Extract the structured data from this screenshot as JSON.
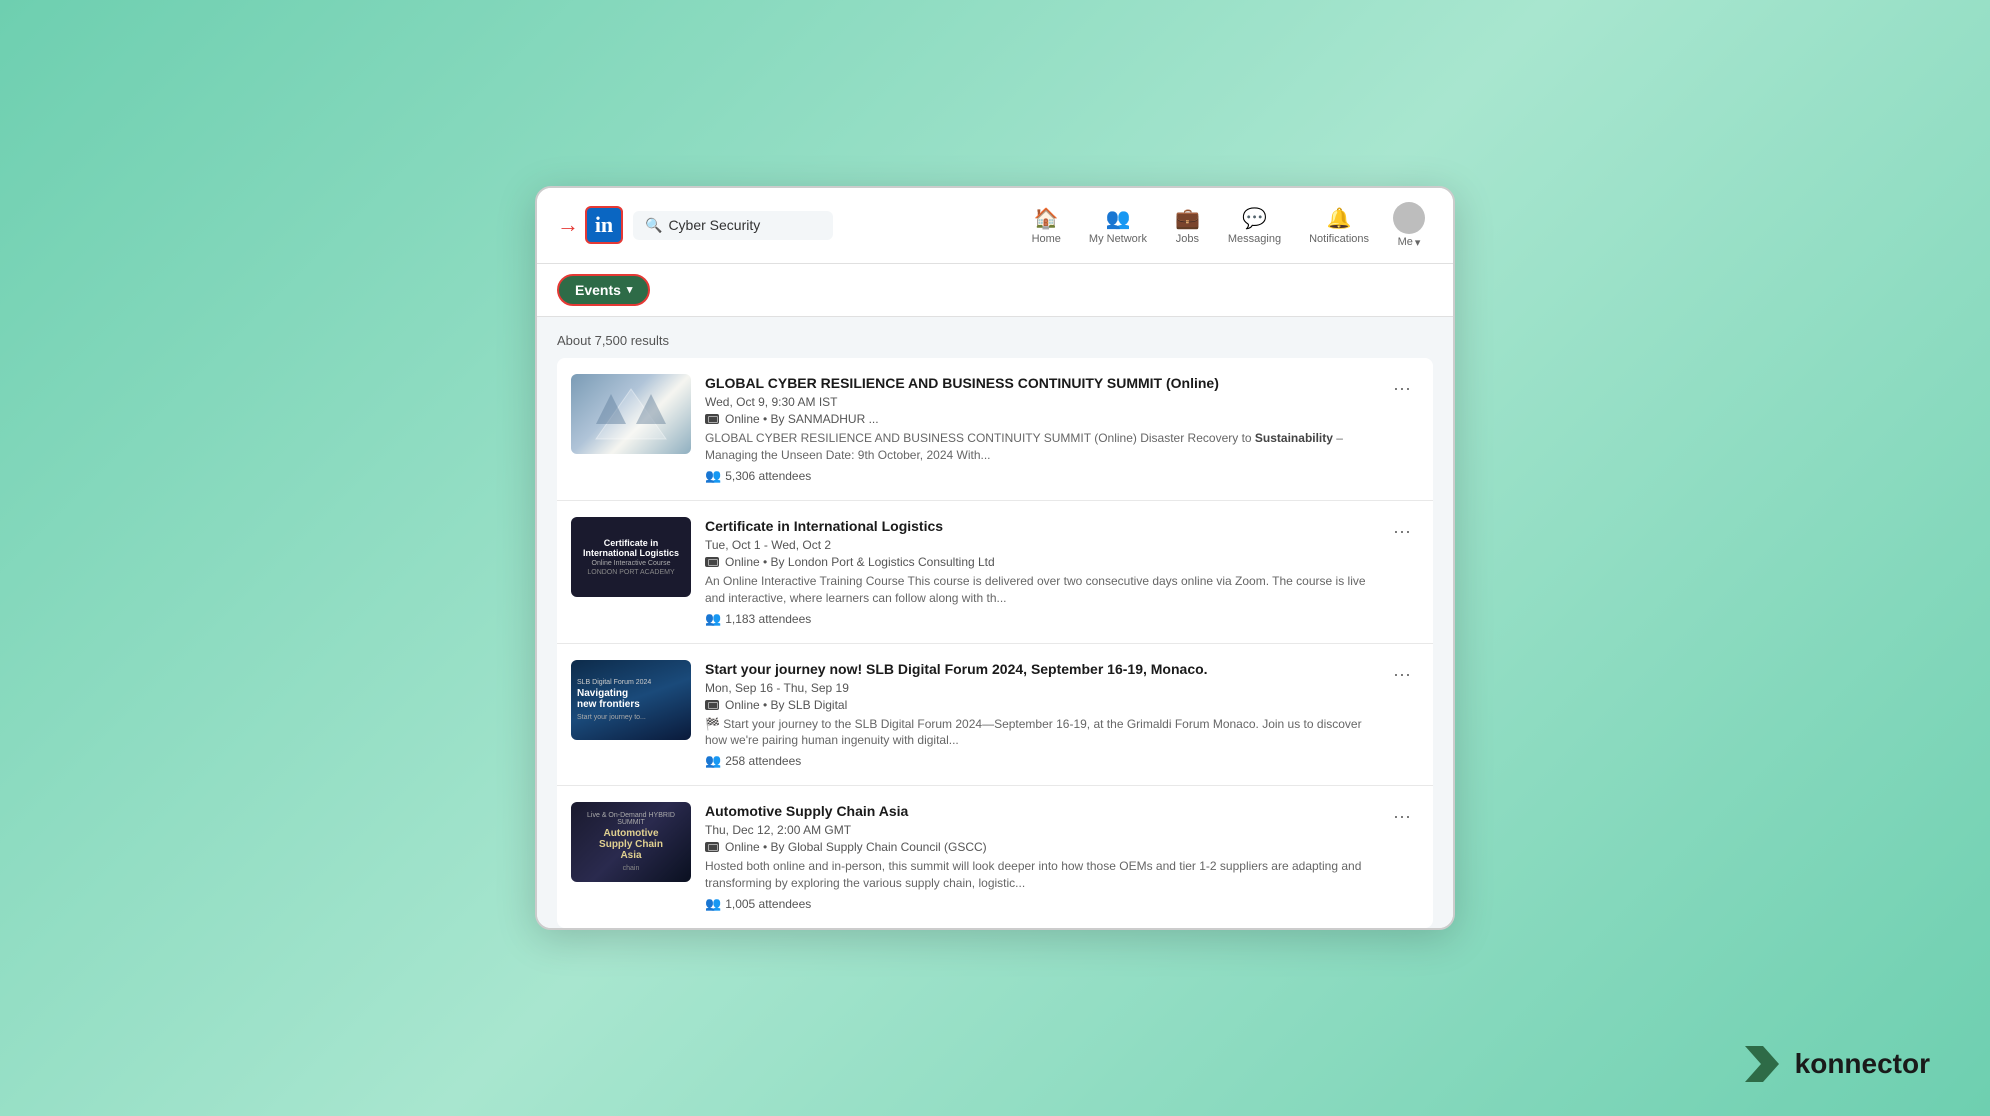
{
  "navbar": {
    "logo_label": "in",
    "search_value": "Cyber Security",
    "search_placeholder": "Cyber Security",
    "nav_items": [
      {
        "id": "home",
        "label": "Home",
        "icon": "🏠"
      },
      {
        "id": "network",
        "label": "My Network",
        "icon": "👥"
      },
      {
        "id": "jobs",
        "label": "Jobs",
        "icon": "💼"
      },
      {
        "id": "messaging",
        "label": "Messaging",
        "icon": "💬"
      },
      {
        "id": "notifications",
        "label": "Notifications",
        "icon": "🔔"
      }
    ],
    "me_label": "Me"
  },
  "filter": {
    "events_btn_label": "Events",
    "events_btn_arrow": "▾"
  },
  "results": {
    "count_text": "About 7,500 results"
  },
  "events": [
    {
      "id": 1,
      "title": "GLOBAL CYBER RESILIENCE AND BUSINESS CONTINUITY SUMMIT (Online)",
      "date": "Wed, Oct 9, 9:30 AM IST",
      "location": "Online • By SANMADHUR ...",
      "description": "GLOBAL CYBER RESILIENCE AND BUSINESS CONTINUITY SUMMIT (Online) Disaster Recovery to Sustainability – Managing the Unseen Date: 9th October, 2024 With...",
      "bold_word": "Sustainability",
      "attendees": "5,306 attendees",
      "thumb_type": "1"
    },
    {
      "id": 2,
      "title": "Certificate in International Logistics",
      "date": "Tue, Oct 1 - Wed, Oct 2",
      "location": "Online • By London Port & Logistics Consulting Ltd",
      "description": "An Online Interactive Training Course This course is delivered over two consecutive days online via Zoom. The course is live and interactive, where learners can follow along with th...",
      "bold_word": "",
      "attendees": "1,183 attendees",
      "thumb_type": "2",
      "thumb_title": "Certificate in International Logistics",
      "thumb_sub": "Online Interactive Course"
    },
    {
      "id": 3,
      "title": "Start your journey now! SLB Digital Forum 2024, September 16-19, Monaco.",
      "date": "Mon, Sep 16 - Thu, Sep 19",
      "location": "Online • By SLB Digital",
      "description": "🏁 Start your journey to the SLB Digital Forum 2024—September 16-19, at the Grimaldi Forum Monaco. Join us to discover how we're pairing human ingenuity with digital...",
      "bold_word": "",
      "attendees": "258 attendees",
      "thumb_type": "3",
      "thumb_tag": "SLB Digital Forum 2024",
      "thumb_title": "Navigating new frontiers"
    },
    {
      "id": 4,
      "title": "Automotive Supply Chain Asia",
      "date": "Thu, Dec 12, 2:00 AM GMT",
      "location": "Online • By Global Supply Chain Council (GSCC)",
      "description": "Hosted both online and in-person, this summit will look deeper into how those OEMs and tier 1-2 suppliers are adapting and transforming by exploring the various supply chain, logistic...",
      "bold_word": "",
      "attendees": "1,005 attendees",
      "thumb_type": "4",
      "thumb_title": "Automotive Supply Chain Asia",
      "thumb_sub": "chain"
    }
  ],
  "branding": {
    "name": "konnector"
  }
}
